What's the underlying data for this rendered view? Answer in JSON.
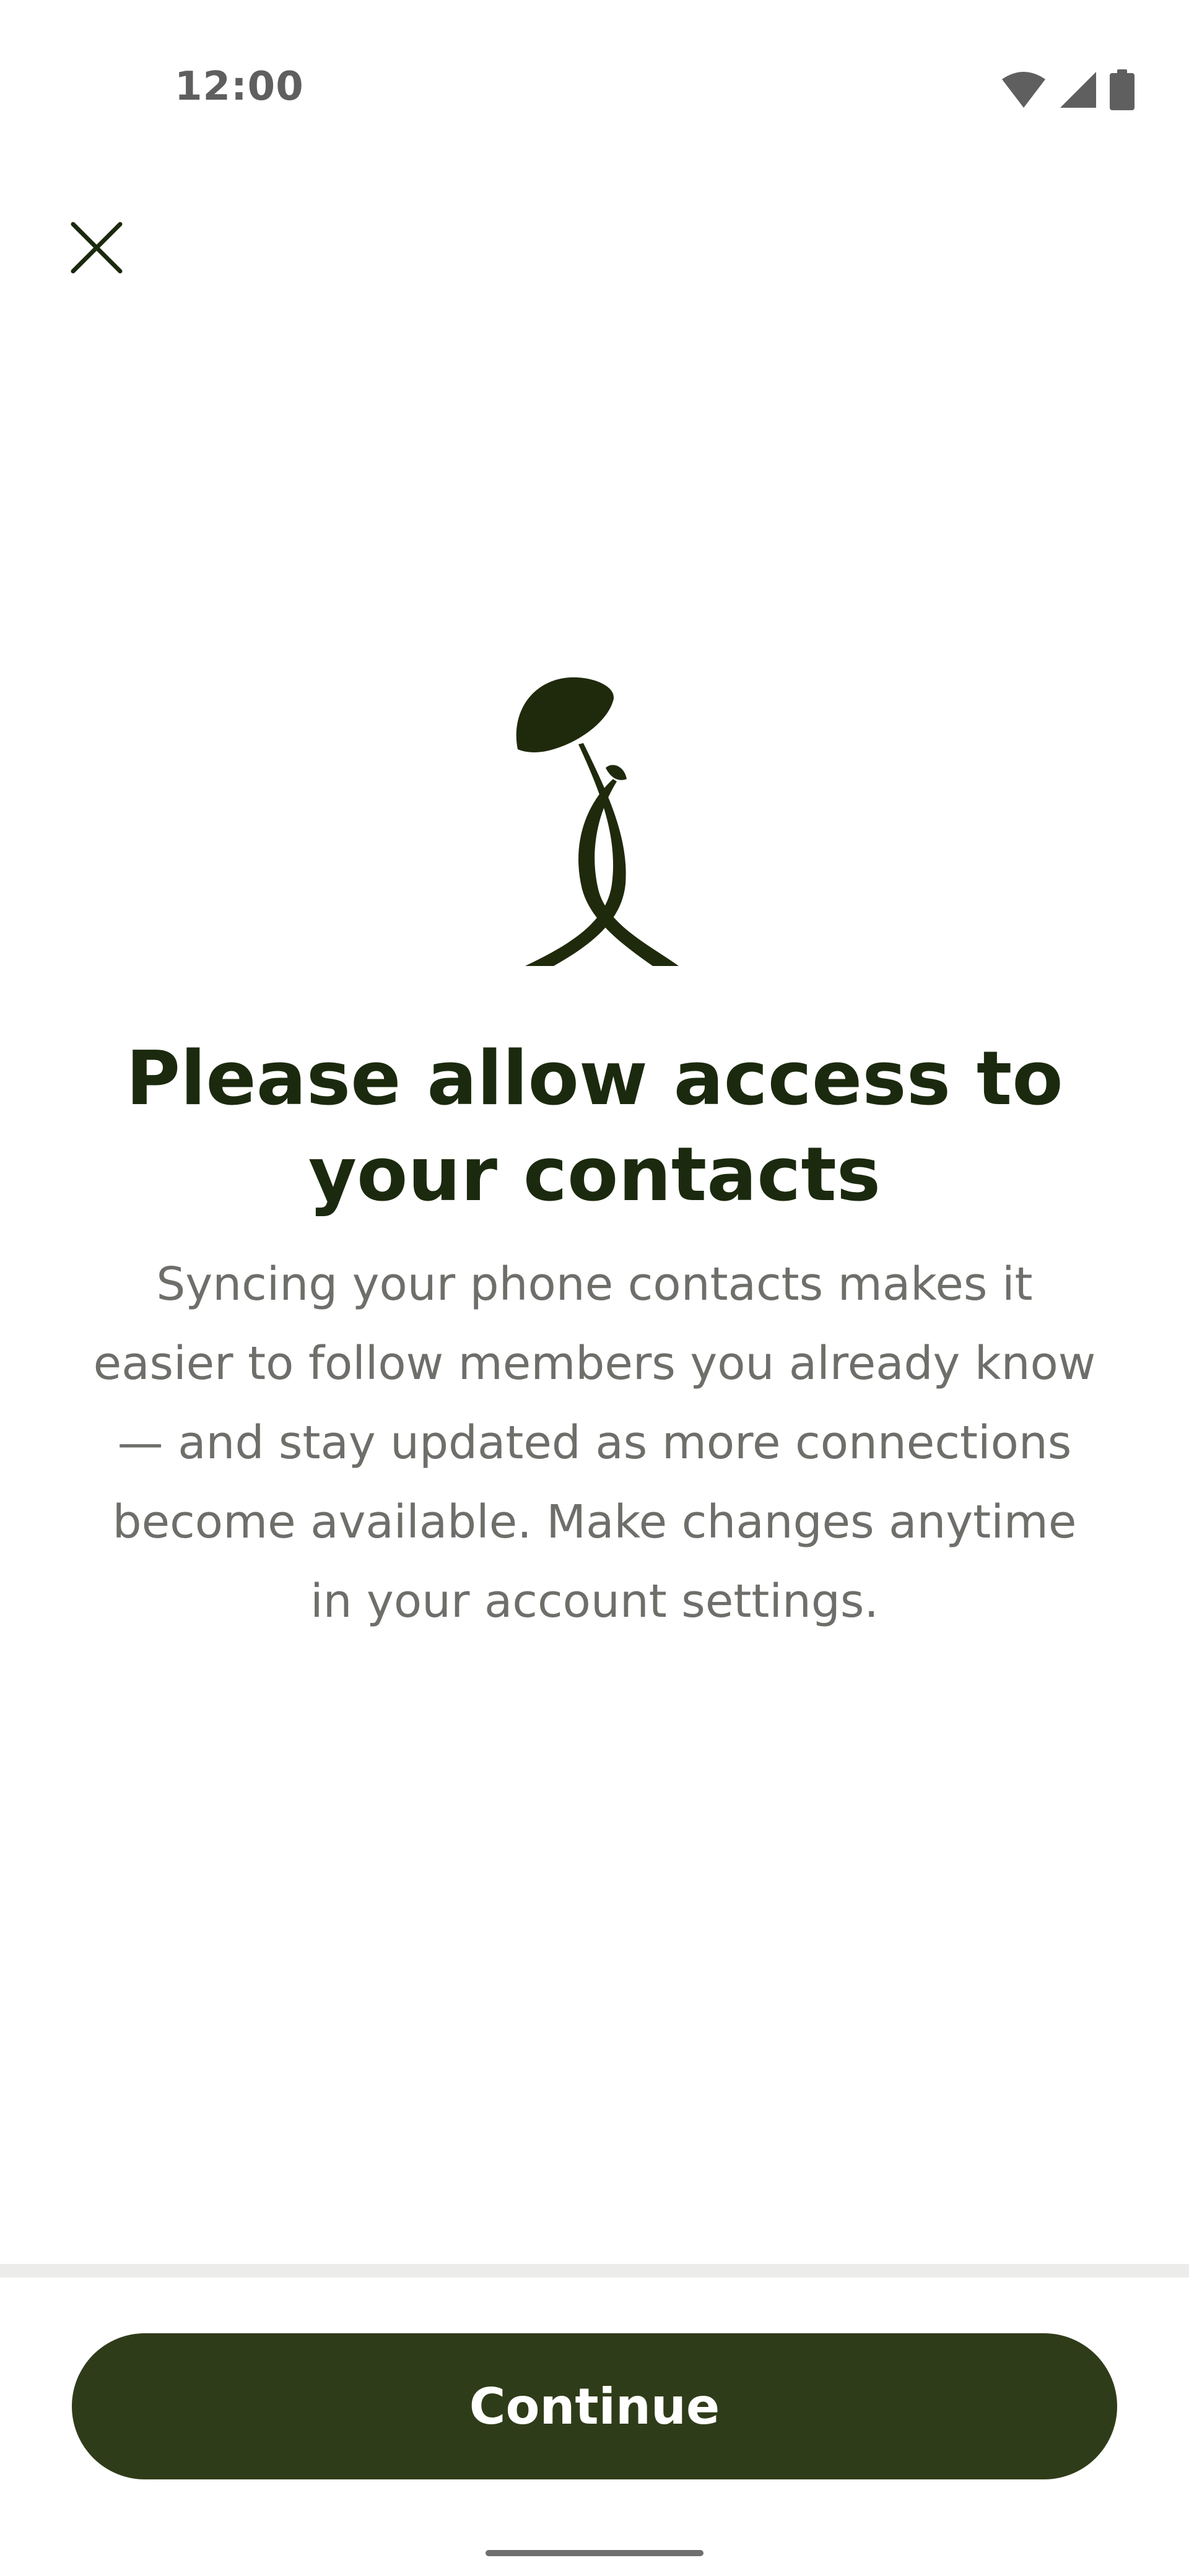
{
  "status_bar": {
    "time": "12:00",
    "icons": [
      "wifi-icon",
      "cellular-signal-icon",
      "battery-icon"
    ]
  },
  "header": {
    "close_icon": "close-icon"
  },
  "content": {
    "illustration_icon": "plant-sprout-illustration-icon",
    "title": "Please allow access to your contacts",
    "body": "Syncing your phone contacts makes it easier to follow members you already know — and stay updated as more connections become available. Make changes anytime in your account settings."
  },
  "footer": {
    "continue_label": "Continue"
  },
  "colors": {
    "primary": "#2f3c19",
    "title": "#1b2a0e",
    "body": "#6e6e6a",
    "background": "#ffffff"
  }
}
